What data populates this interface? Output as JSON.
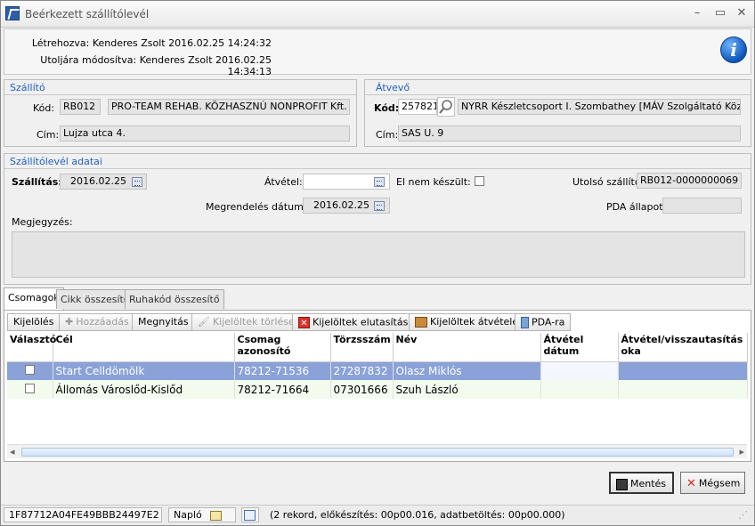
{
  "window": {
    "title": "Beérkezett szállítólevél",
    "min": "–",
    "max": "▭",
    "close": "✕"
  },
  "info": {
    "created": "Létrehozva: Kenderes Zsolt 2016.02.25 14:24:32",
    "modified": "Utoljára módosítva: Kenderes Zsolt 2016.02.25 14:34:13"
  },
  "supplier": {
    "title": "Szállító",
    "code_label": "Kód:",
    "code": "RB012",
    "name": "PRO-TEAM REHAB. KÖZHASZNÚ NONPROFIT Kft.",
    "addr_label": "Cím:",
    "addr": "Lujza utca 4."
  },
  "receiver": {
    "title": "Átvevő",
    "code_label": "Kód:",
    "code": "257821",
    "name": "NYRR Készletcsoport I. Szombathey [MÁV Szolgáltató Központ Zr",
    "addr_label": "Cím:",
    "addr": "SAS U. 9"
  },
  "delivery": {
    "title": "Szállítólevél adatai",
    "ship_label": "Szállítás:",
    "ship_date": "2016.02.25",
    "receipt_label": "Átvétel:",
    "receipt_date": "",
    "notdone_label": "El nem készült:",
    "last_label": "Utolsó szállító:",
    "last_value": "RB012-0000000069",
    "order_label": "Megrendelés dátuma:",
    "order_date": "2016.02.25",
    "pda_label": "PDA állapot:",
    "pda_value": "",
    "note_label": "Megjegyzés:"
  },
  "tabs": [
    "Csomagok",
    "Cikk összesítő",
    "Ruhakód összesítő"
  ],
  "toolbar": {
    "select": "Kijelölés",
    "add": "Hozzáadás",
    "open": "Megnyitás",
    "delete": "Kijelöltek törlése",
    "reject": "Kijelöltek elutasítása",
    "accept": "Kijelöltek átvétele",
    "pda": "PDA-ra"
  },
  "grid": {
    "headers": [
      "Választó",
      "Cél",
      "Csomag azonosító",
      "Törzsszám",
      "Név",
      "Átvétel dátum",
      "Átvétel/visszautasítás oka"
    ],
    "rows": [
      {
        "target": "Start Celldömölk",
        "package": "78212-71536",
        "id": "27287832",
        "name": "Olasz Miklós",
        "date": "",
        "reason": ""
      },
      {
        "target": "Állomás Városlőd-Kislőd",
        "package": "78212-71664",
        "id": "07301666",
        "name": "Szuh László",
        "date": "",
        "reason": ""
      }
    ]
  },
  "buttons": {
    "save": "Mentés",
    "cancel": "Mégsem"
  },
  "status": {
    "guid": "1F87712A04FE49BBB24497E2",
    "log": "Napló",
    "text": "(2 rekord, előkészítés: 00p00.016, adatbetöltés: 00p00.000)"
  }
}
